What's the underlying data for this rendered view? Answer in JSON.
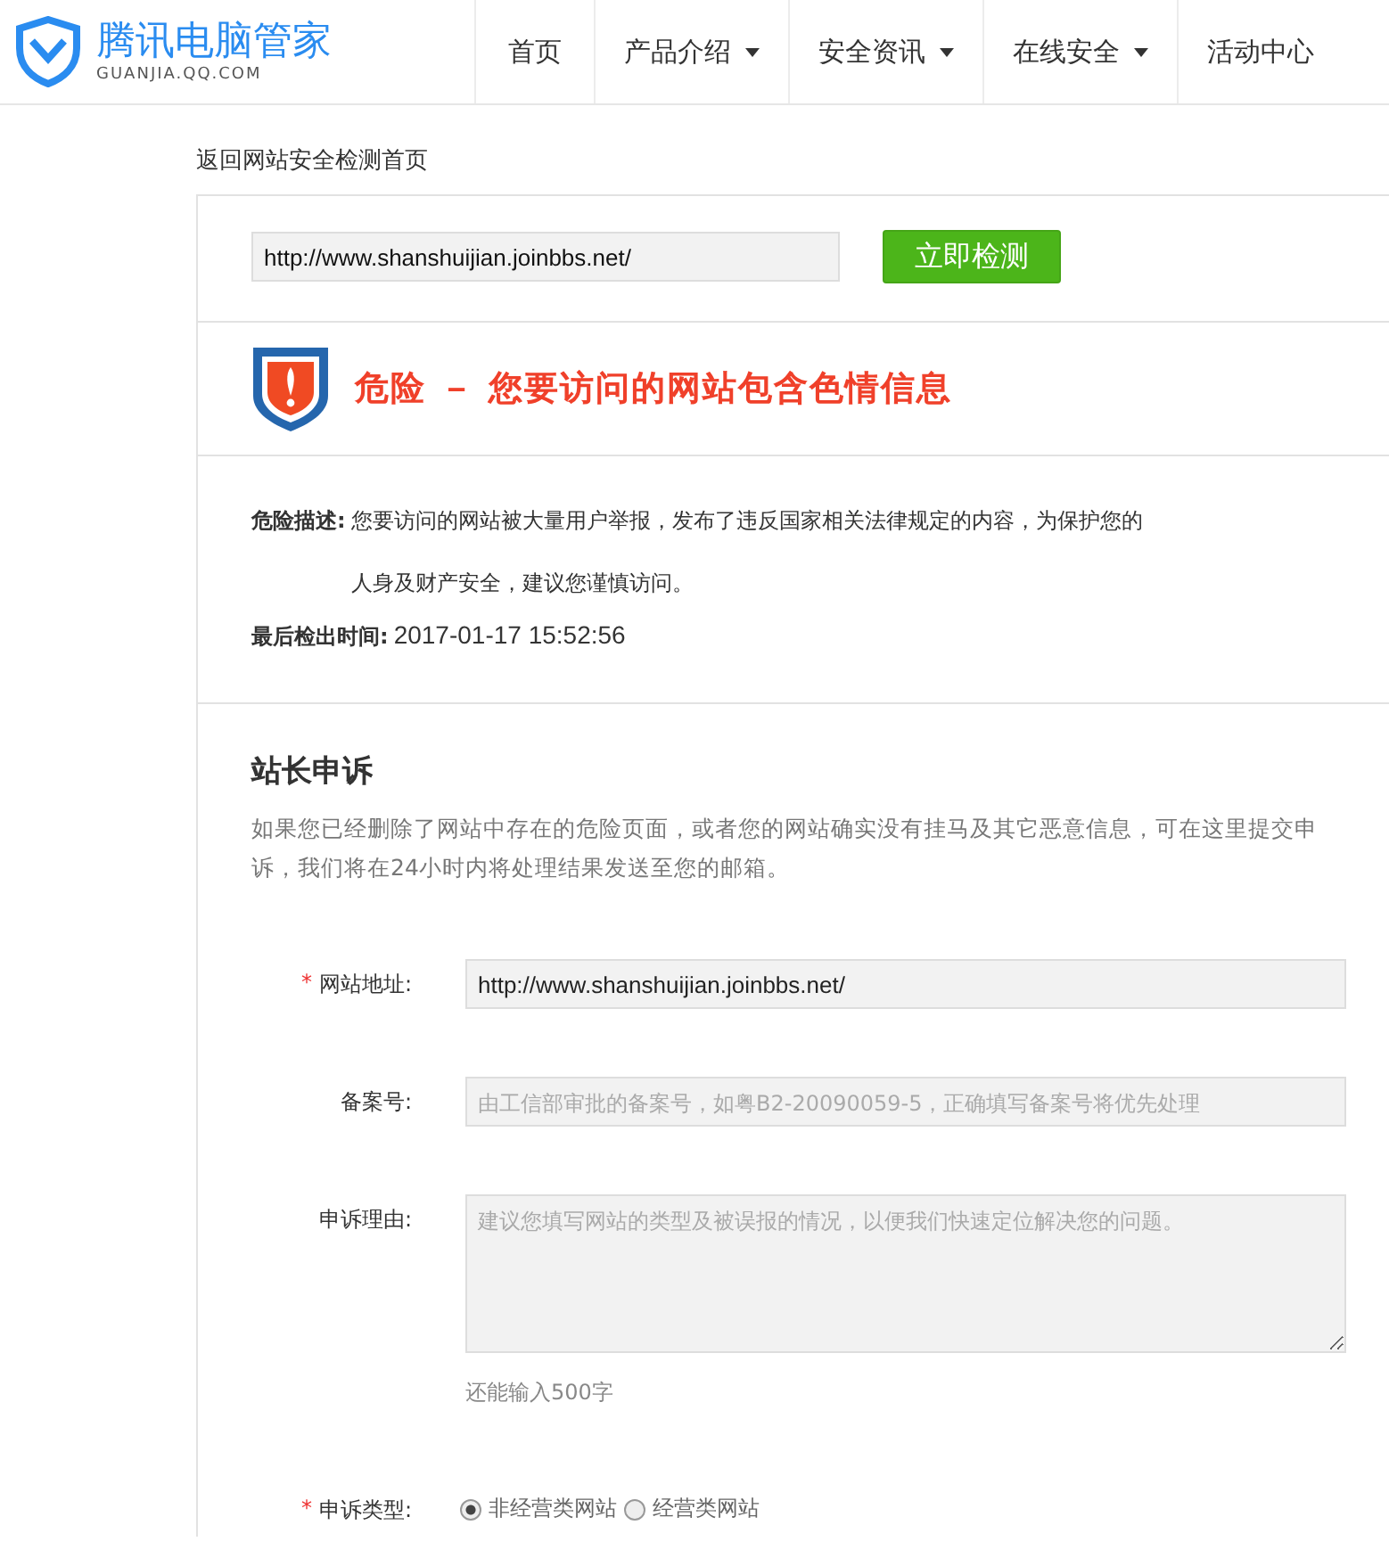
{
  "header": {
    "brand": "腾讯电脑管家",
    "domain": "GUANJIA.QQ.COM",
    "nav": [
      {
        "label": "首页",
        "dropdown": false
      },
      {
        "label": "产品介绍",
        "dropdown": true
      },
      {
        "label": "安全资讯",
        "dropdown": true
      },
      {
        "label": "在线安全",
        "dropdown": true
      },
      {
        "label": "活动中心",
        "dropdown": false
      }
    ]
  },
  "back_link": "返回网站安全检测首页",
  "check": {
    "value": "http://www.shanshuijian.joinbbs.net/",
    "button": "立即检测"
  },
  "verdict": {
    "kind": "danger",
    "title": "危险 － 您要访问的网站包含色情信息"
  },
  "details": {
    "desc_label": "危险描述:",
    "desc_line1": "您要访问的网站被大量用户举报，发布了违反国家相关法律规定的内容，为保护您的",
    "desc_line2": "人身及财产安全，建议您谨慎访问。",
    "time_label": "最后检出时间:",
    "time": "2017-01-17 15:52:56"
  },
  "appeal": {
    "title": "站长申诉",
    "required_mark": "*",
    "intro": "如果您已经删除了网站中存在的危险页面，或者您的网站确实没有挂马及其它恶意信息，可在这里提交申诉，我们将在24小时内将处理结果发送至您的邮箱。",
    "fields": [
      {
        "kind": "input",
        "label": "网站地址:",
        "required": true,
        "value": "http://www.shanshuijian.joinbbs.net/"
      },
      {
        "kind": "input",
        "label": "备案号:",
        "required": false,
        "placeholder": "由工信部审批的备案号，如粤B2-20090059-5，正确填写备案号将优先处理"
      },
      {
        "kind": "textarea",
        "label": "申诉理由:",
        "required": false,
        "placeholder": "建议您填写网站的类型及被误报的情况，以便我们快速定位解决您的问题。",
        "hint": "还能输入500字"
      },
      {
        "kind": "radio",
        "label": "申诉类型:",
        "required": true,
        "options": [
          {
            "label": "非经营类网站",
            "selected": true
          },
          {
            "label": "经营类网站",
            "selected": false
          }
        ]
      }
    ]
  }
}
